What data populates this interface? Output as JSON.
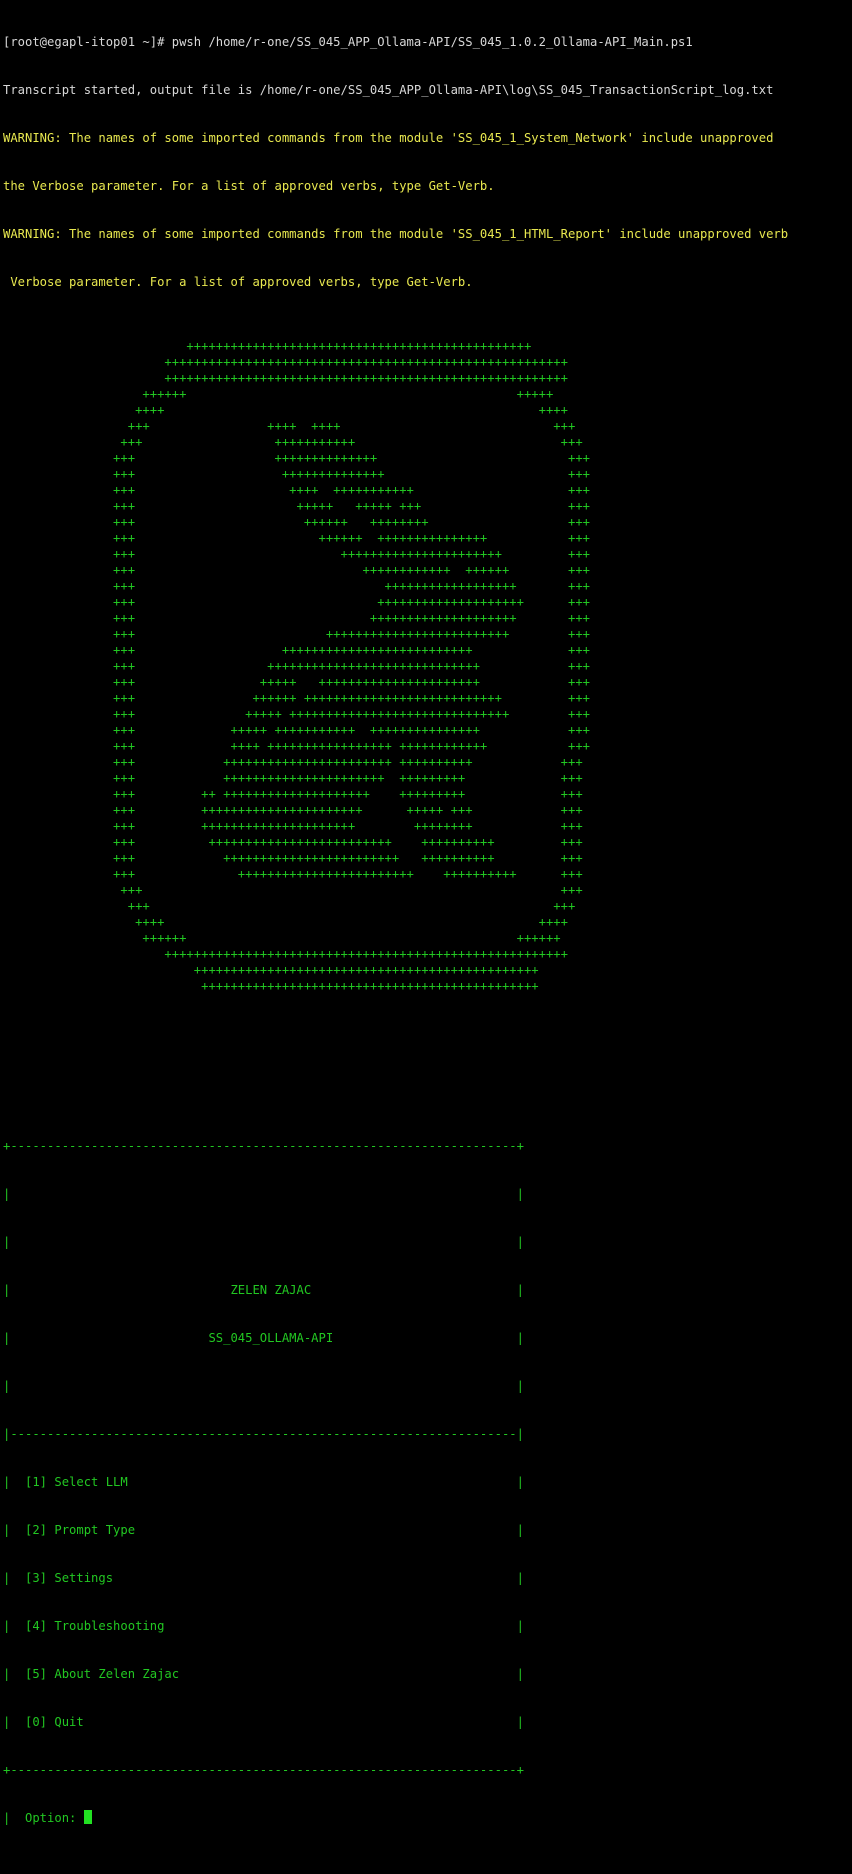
{
  "colors": {
    "background": "#000000",
    "prompt_text": "#d8d8d8",
    "warning_text": "#e8e84f",
    "menu_text": "#22c722",
    "cursor": "#22e022"
  },
  "header": {
    "command_line": "[root@egapl-itop01 ~]# pwsh /home/r-one/SS_045_APP_Ollama-API/SS_045_1.0.2_Ollama-API_Main.ps1",
    "transcript": "Transcript started, output file is /home/r-one/SS_045_APP_Ollama-API\\log\\SS_045_TransactionScript_log.txt",
    "warnings": [
      "WARNING: The names of some imported commands from the module 'SS_045_1_System_Network' include unapproved",
      "the Verbose parameter. For a list of approved verbs, type Get-Verb.",
      "WARNING: The names of some imported commands from the module 'SS_045_1_HTML_Report' include unapproved verb",
      " Verbose parameter. For a list of approved verbs, type Get-Verb."
    ]
  },
  "logo_art": [
    "                         +++++++++++++++++++++++++++++++++++++++++++++++",
    "                      +++++++++++++++++++++++++++++++++++++++++++++++++++++++",
    "                      +++++++++++++++++++++++++++++++++++++++++++++++++++++++",
    "                   ++++++                                             +++++",
    "                  ++++                                                   ++++",
    "                 +++                ++++  ++++                             +++",
    "                +++                  +++++++++++                            +++",
    "               +++                   ++++++++++++++                          +++",
    "               +++                    ++++++++++++++                         +++",
    "               +++                     ++++  +++++++++++                     +++",
    "               +++                      +++++   +++++ +++                    +++",
    "               +++                       ++++++   ++++++++                   +++",
    "               +++                         ++++++  +++++++++++++++           +++",
    "               +++                            ++++++++++++++++++++++         +++",
    "               +++                               ++++++++++++  ++++++        +++",
    "               +++                                  ++++++++++++++++++       +++",
    "               +++                                 ++++++++++++++++++++      +++",
    "               +++                                ++++++++++++++++++++       +++",
    "               +++                          +++++++++++++++++++++++++        +++",
    "               +++                    ++++++++++++++++++++++++++             +++",
    "               +++                  +++++++++++++++++++++++++++++            +++",
    "               +++                 +++++   ++++++++++++++++++++++            +++",
    "               +++                ++++++ +++++++++++++++++++++++++++         +++",
    "               +++               +++++ ++++++++++++++++++++++++++++++        +++",
    "               +++             +++++ +++++++++++  +++++++++++++++            +++",
    "               +++             ++++ +++++++++++++++++ ++++++++++++           +++",
    "               +++            +++++++++++++++++++++++ ++++++++++            +++",
    "               +++            ++++++++++++++++++++++  +++++++++             +++",
    "               +++         ++ ++++++++++++++++++++    +++++++++             +++",
    "               +++         ++++++++++++++++++++++      +++++ +++            +++",
    "               +++         +++++++++++++++++++++        ++++++++            +++",
    "               +++          +++++++++++++++++++++++++    ++++++++++         +++",
    "               +++            ++++++++++++++++++++++++   ++++++++++         +++",
    "               +++              ++++++++++++++++++++++++    ++++++++++      +++",
    "                +++                                                         +++",
    "                 +++                                                       +++",
    "                  ++++                                                   ++++",
    "                   ++++++                                             ++++++",
    "                      +++++++++++++++++++++++++++++++++++++++++++++++++++++++",
    "                          +++++++++++++++++++++++++++++++++++++++++++++++",
    "                           ++++++++++++++++++++++++++++++++++++++++++++++"
  ],
  "menu": {
    "border_top": "+---------------------------------------------------------------------+",
    "blank_line": "|                                                                     |",
    "title_line": "|                              ZELEN ZAJAC                            |",
    "subtitle_line": "|                           SS_045_OLLAMA-API                         |",
    "divider": "|---------------------------------------------------------------------|",
    "items": [
      "|  [1] Select LLM                                                     |",
      "|  [2] Prompt Type                                                    |",
      "|  [3] Settings                                                       |",
      "|  [4] Troubleshooting                                                |",
      "|  [5] About Zelen Zajac                                              |",
      "|  [0] Quit                                                           |"
    ],
    "border_bottom": "+---------------------------------------------------------------------+",
    "option_prompt": "|  Option: "
  }
}
